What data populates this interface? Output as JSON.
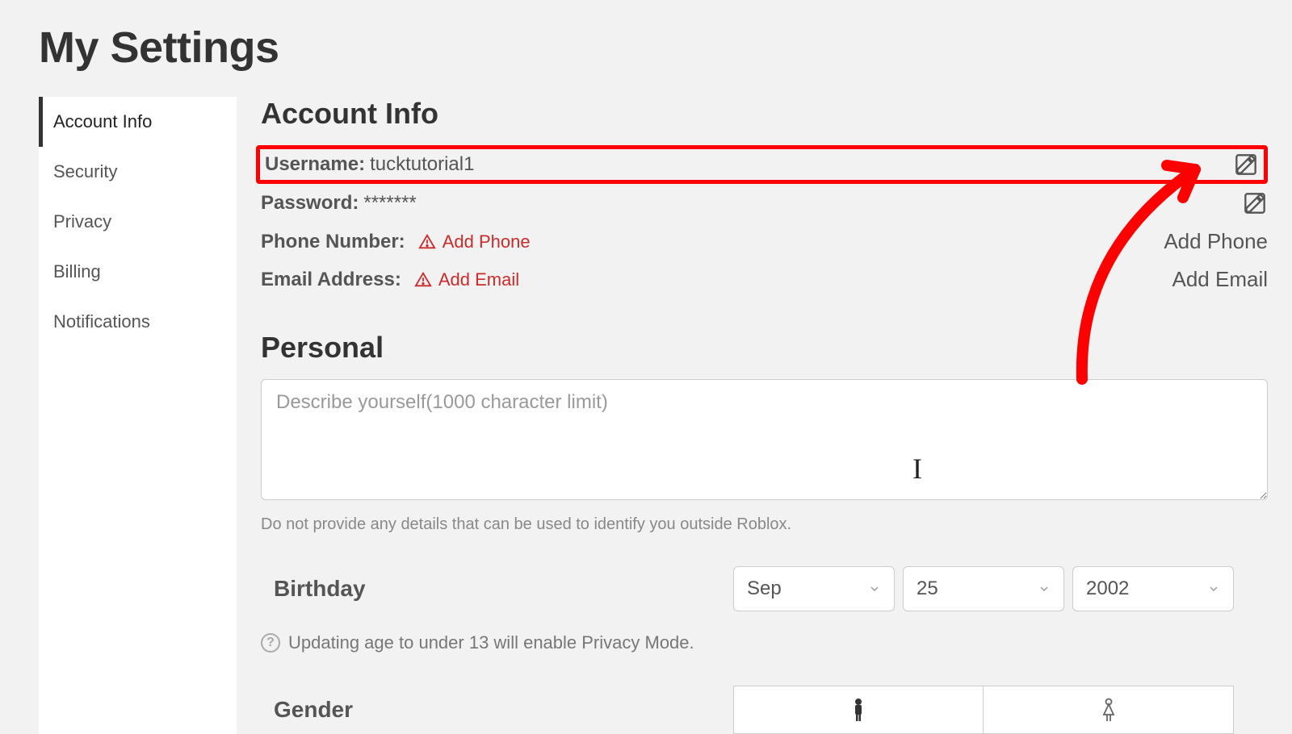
{
  "page_title": "My Settings",
  "sidebar": {
    "items": [
      {
        "label": "Account Info",
        "active": true
      },
      {
        "label": "Security",
        "active": false
      },
      {
        "label": "Privacy",
        "active": false
      },
      {
        "label": "Billing",
        "active": false
      },
      {
        "label": "Notifications",
        "active": false
      }
    ]
  },
  "account_info": {
    "heading": "Account Info",
    "username_label": "Username:",
    "username_value": "tucktutorial1",
    "password_label": "Password:",
    "password_value": "*******",
    "phone_label": "Phone Number:",
    "phone_add_link": "Add Phone",
    "phone_action": "Add Phone",
    "email_label": "Email Address:",
    "email_add_link": "Add Email",
    "email_action": "Add Email"
  },
  "personal": {
    "heading": "Personal",
    "describe_placeholder": "Describe yourself(1000 character limit)",
    "describe_hint": "Do not provide any details that can be used to identify you outside Roblox.",
    "birthday_label": "Birthday",
    "birthday_month": "Sep",
    "birthday_day": "25",
    "birthday_year": "2002",
    "age_hint": "Updating age to under 13 will enable Privacy Mode.",
    "gender_label": "Gender"
  },
  "annotation": {
    "highlight": "username-row",
    "arrow_points_to": "edit-username-icon"
  }
}
